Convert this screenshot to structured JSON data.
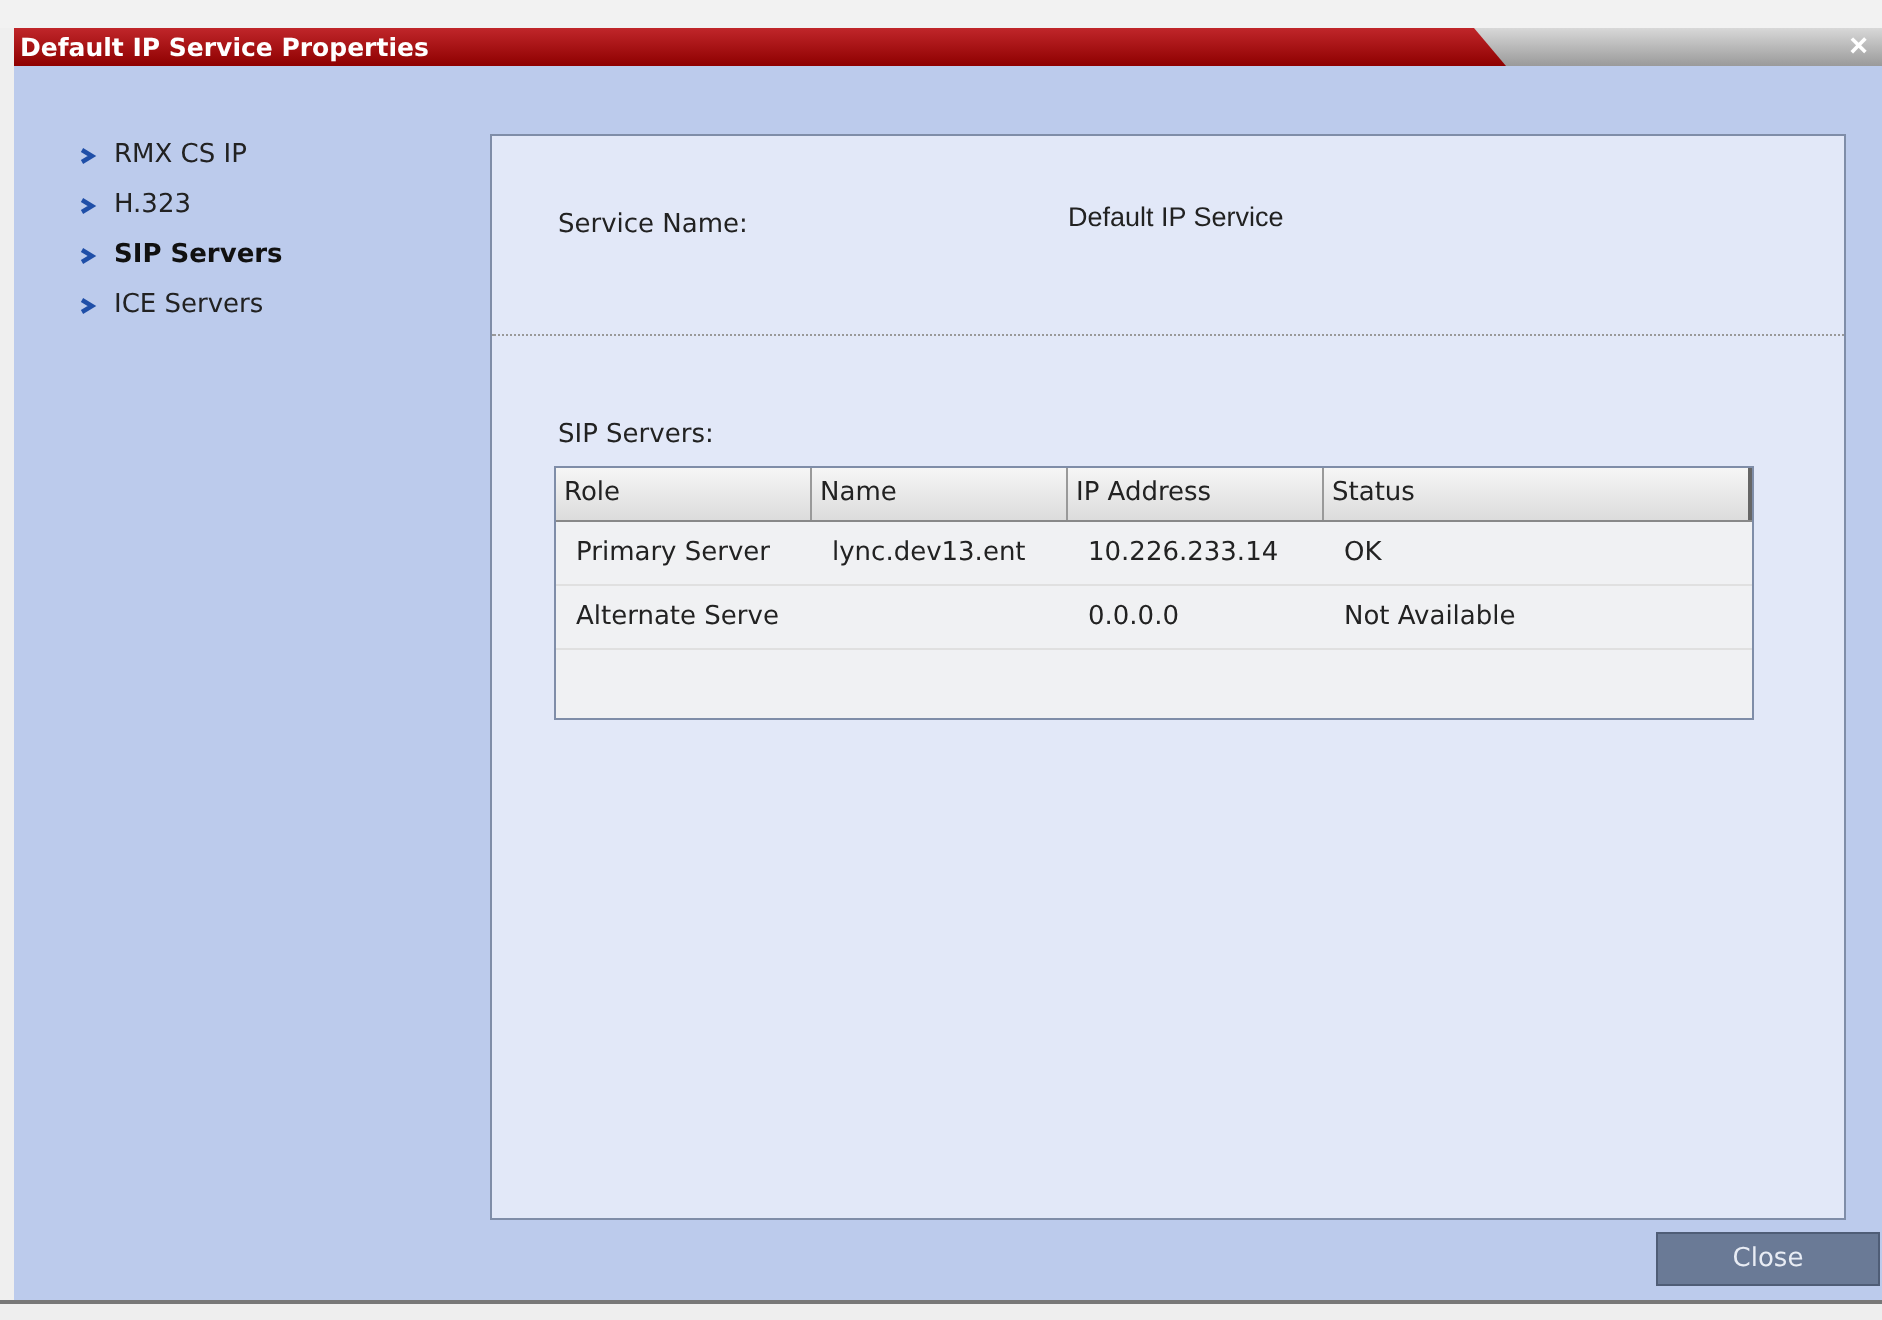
{
  "window": {
    "title": "Default IP Service Properties",
    "close": "×"
  },
  "sidebar": {
    "items": [
      {
        "label": "RMX CS IP",
        "selected": false
      },
      {
        "label": "H.323",
        "selected": false
      },
      {
        "label": "SIP Servers",
        "selected": true
      },
      {
        "label": "ICE Servers",
        "selected": false
      }
    ]
  },
  "service_name": {
    "label": "Service Name:",
    "value": "Default IP Service"
  },
  "sip_servers": {
    "label": "SIP Servers:",
    "columns": [
      "Role",
      "Name",
      "IP Address",
      "Status"
    ],
    "rows": [
      [
        "Primary Server",
        "lync.dev13.ent",
        "10.226.233.14",
        "OK"
      ],
      [
        "Alternate Serve",
        "",
        "0.0.0.0",
        "Not Available"
      ]
    ]
  },
  "buttons": [
    "Close"
  ]
}
